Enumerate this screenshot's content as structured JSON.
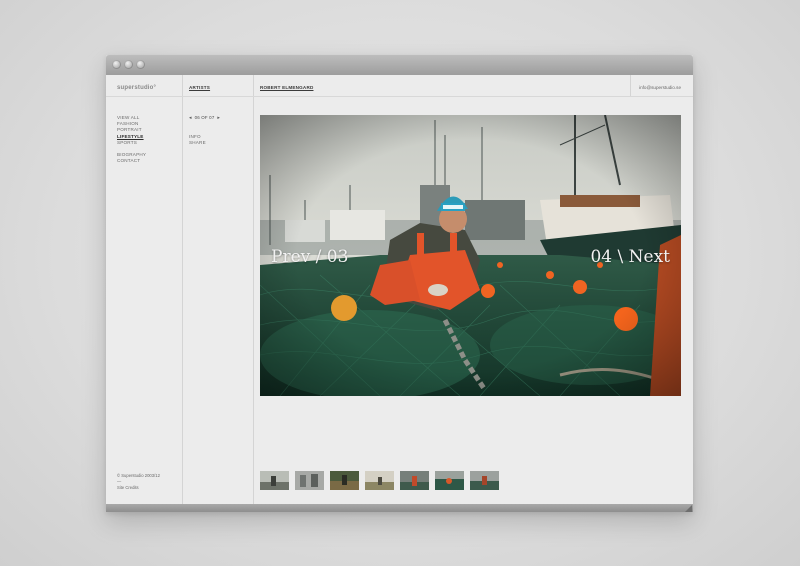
{
  "brand": {
    "logo": "superstudio°"
  },
  "topbar": {
    "artists_link": "ARTISTS",
    "artist_name": "ROBERT ELMENGARD",
    "email": "info@superstudio.se"
  },
  "nav": {
    "items": [
      "VIEW ALL",
      "FASHION",
      "PORTRAIT",
      "LIFESTYLE",
      "SPORTS"
    ],
    "active": "LIFESTYLE",
    "extra": [
      "BIOGRAPHY",
      "CONTACT"
    ]
  },
  "gallery": {
    "prev_arrow": "◂",
    "counter": "06 OF 07",
    "next_arrow": "▸",
    "info": "INFO",
    "share": "SHARE",
    "prev_label": "Prev / 03",
    "next_label": "04 \\ Next"
  },
  "footer": {
    "copyright": "© Superstudio 2003/12",
    "dash": "—",
    "site_credits": "Site Credits"
  },
  "thumbnails": {
    "count": 7
  }
}
